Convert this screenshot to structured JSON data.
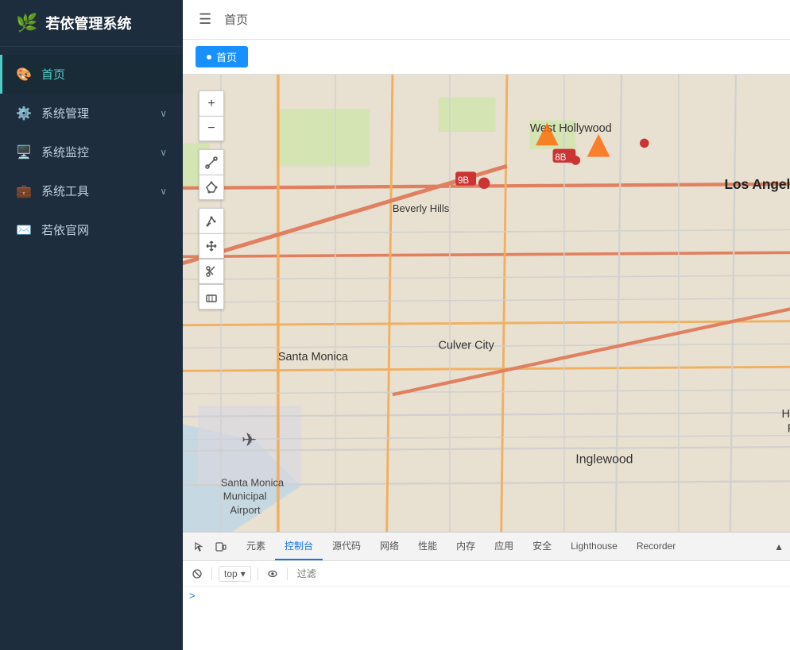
{
  "sidebar": {
    "logo": {
      "icon": "🌿",
      "text": "若依管理系统"
    },
    "items": [
      {
        "id": "home",
        "icon": "🎨",
        "label": "首页",
        "active": true,
        "arrow": false
      },
      {
        "id": "system",
        "icon": "⚙️",
        "label": "系统管理",
        "active": false,
        "arrow": true
      },
      {
        "id": "monitor",
        "icon": "🖥️",
        "label": "系统监控",
        "active": false,
        "arrow": true
      },
      {
        "id": "tools",
        "icon": "💼",
        "label": "系统工具",
        "active": false,
        "arrow": true
      },
      {
        "id": "website",
        "icon": "✉️",
        "label": "若依官网",
        "active": false,
        "arrow": false
      }
    ]
  },
  "header": {
    "menu_icon": "☰",
    "title": "首页"
  },
  "tabbar": {
    "active_tab": "首页",
    "dot": "●"
  },
  "devtools": {
    "left_icons": [
      "cursor",
      "device"
    ],
    "tabs": [
      {
        "id": "elements",
        "label": "元素",
        "active": false
      },
      {
        "id": "console",
        "label": "控制台",
        "active": true
      },
      {
        "id": "sources",
        "label": "源代码",
        "active": false
      },
      {
        "id": "network",
        "label": "网络",
        "active": false
      },
      {
        "id": "performance",
        "label": "性能",
        "active": false
      },
      {
        "id": "memory",
        "label": "内存",
        "active": false
      },
      {
        "id": "application",
        "label": "应用",
        "active": false
      },
      {
        "id": "security",
        "label": "安全",
        "active": false
      },
      {
        "id": "lighthouse",
        "label": "Lighthouse",
        "active": false
      },
      {
        "id": "recorder",
        "label": "Recorder",
        "active": false
      }
    ],
    "toolbar": {
      "context_label": "top",
      "eye_label": "👁",
      "filter_placeholder": "过滤"
    },
    "console_prompt": ">"
  },
  "map": {
    "zoom_in": "+",
    "zoom_out": "−",
    "controls": [
      "draw-line",
      "draw-polygon",
      "edit",
      "move",
      "cut",
      "erase"
    ]
  }
}
